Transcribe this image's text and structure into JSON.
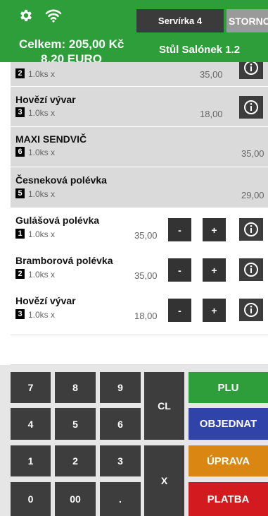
{
  "header": {
    "server_label": "Servírka 4",
    "storno_label": "STORNO",
    "total_czk": "Celkem: 205,00 Kč",
    "total_eur": "8,20 EURO",
    "table_label": "Stůl Salónek 1.2",
    "icons": [
      "gear-icon",
      "wifi-icon"
    ],
    "colors": {
      "header_bg": "#2e9e3a",
      "server_bg": "#3b3b3b",
      "storno_bg": "#9a9a9a"
    }
  },
  "order": {
    "sent_items": [
      {
        "name": "",
        "seq": "2",
        "qty": "1.0ks x",
        "price": "35,00",
        "has_info": true
      },
      {
        "name": "Hovězí vývar",
        "seq": "3",
        "qty": "1.0ks x",
        "price": "18,00",
        "has_info": true
      },
      {
        "name": "MAXI SENDVIČ",
        "seq": "6",
        "qty": "1.0ks x",
        "price": "35,00",
        "has_info": false
      },
      {
        "name": "Česneková polévka",
        "seq": "5",
        "qty": "1.0ks x",
        "price": "29,00",
        "has_info": false
      }
    ],
    "open_items": [
      {
        "name": "Gulášová polévka",
        "seq": "1",
        "qty": "1.0ks x",
        "price": "35,00",
        "minus": "-",
        "plus": "+"
      },
      {
        "name": "Bramborová polévka",
        "seq": "2",
        "qty": "1.0ks x",
        "price": "35,00",
        "minus": "-",
        "plus": "+"
      },
      {
        "name": "Hovězí vývar",
        "seq": "3",
        "qty": "1.0ks x",
        "price": "18,00",
        "minus": "-",
        "plus": "+"
      }
    ]
  },
  "input": {
    "value": ""
  },
  "keypad": {
    "digits": [
      "7",
      "8",
      "9",
      "4",
      "5",
      "6",
      "1",
      "2",
      "3",
      "0",
      "00",
      "."
    ],
    "clear": "CL",
    "times": "X",
    "plu": "PLU",
    "order": "OBJEDNAT",
    "edit": "ÚPRAVA",
    "pay": "PLATBA",
    "colors": {
      "plu": "#2e9e3a",
      "order": "#2f43a8",
      "edit": "#d98613",
      "pay": "#d21a1f",
      "key": "#3d3d3d"
    }
  }
}
